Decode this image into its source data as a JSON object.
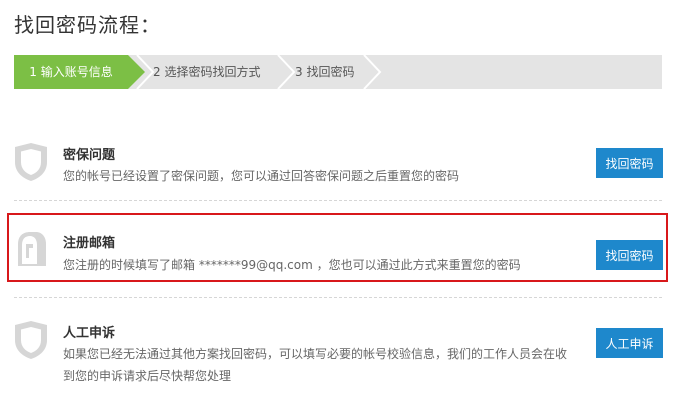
{
  "page": {
    "title": "找回密码流程："
  },
  "steps": [
    {
      "label": "1 输入账号信息"
    },
    {
      "label": "2 选择密码找回方式"
    },
    {
      "label": "3 找回密码"
    }
  ],
  "options": [
    {
      "title": "密保问题",
      "desc": "您的帐号已经设置了密保问题，您可以通过回答密保问题之后重置您的密码",
      "button": "找回密码",
      "icon": "shield-icon"
    },
    {
      "title": "注册邮箱",
      "desc": "您注册的时候填写了邮箱 *******99@qq.com ，您也可以通过此方式来重置您的密码",
      "button": "找回密码",
      "icon": "mailbox-icon"
    },
    {
      "title": "人工申诉",
      "desc": "如果您已经无法通过其他方案找回密码，可以填写必要的帐号校验信息，我们的工作人员会在收到您的申诉请求后尽快帮您处理",
      "button": "人工申诉",
      "icon": "shield-icon"
    }
  ],
  "colors": {
    "active_step": "#7cbf45",
    "button": "#1e88cc",
    "highlight_border": "#d8181b",
    "icon_gray": "#cfcfcf"
  }
}
